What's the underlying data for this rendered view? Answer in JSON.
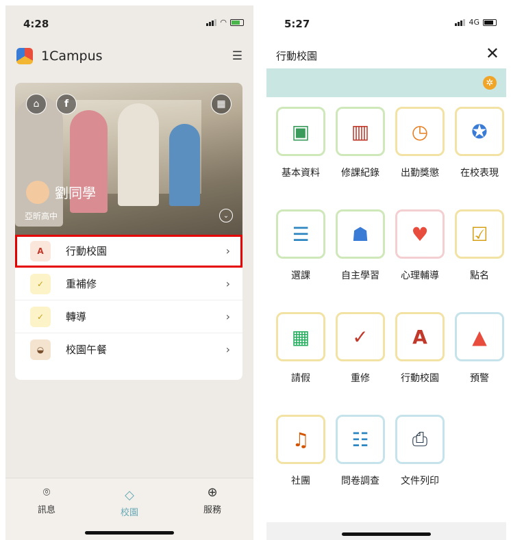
{
  "left": {
    "status": {
      "time": "4:28"
    },
    "app_title": "1Campus",
    "hero": {
      "student_name": "劉同學",
      "school": "亞昕高中"
    },
    "menu": [
      {
        "label": "行動校園",
        "icon": "campus-app-icon",
        "highlighted": true
      },
      {
        "label": "重補修",
        "icon": "checklist-icon"
      },
      {
        "label": "轉導",
        "icon": "checklist-icon"
      },
      {
        "label": "校園午餐",
        "icon": "lunch-icon"
      }
    ],
    "tabs": [
      {
        "label": "訊息",
        "icon": "chat-icon"
      },
      {
        "label": "校園",
        "icon": "graduation-cap-icon",
        "active": true
      },
      {
        "label": "服務",
        "icon": "globe-icon"
      }
    ],
    "highlight_color": "#e50000"
  },
  "right": {
    "status": {
      "time": "5:27",
      "network": "4G"
    },
    "title": "行動校園",
    "grid": [
      {
        "label": "基本資料",
        "icon": "profile-card-icon"
      },
      {
        "label": "修課紀錄",
        "icon": "books-gear-icon"
      },
      {
        "label": "出勤獎懲",
        "icon": "clock-medal-icon"
      },
      {
        "label": "在校表現",
        "icon": "student-award-icon"
      },
      {
        "label": "選課",
        "icon": "book-stack-icon"
      },
      {
        "label": "自主學習",
        "icon": "self-study-icon"
      },
      {
        "label": "心理輔導",
        "icon": "heart-hands-icon"
      },
      {
        "label": "點名",
        "icon": "roll-call-icon"
      },
      {
        "label": "請假",
        "icon": "calendar-icon"
      },
      {
        "label": "重修",
        "icon": "retake-exam-icon"
      },
      {
        "label": "行動校園",
        "icon": "campus-app-icon"
      },
      {
        "label": "預警",
        "icon": "alarm-light-icon"
      },
      {
        "label": "社團",
        "icon": "guitar-ball-icon"
      },
      {
        "label": "問卷調查",
        "icon": "survey-icon"
      },
      {
        "label": "文件列印",
        "icon": "printer-icon"
      }
    ],
    "accent": "#cae6e2"
  }
}
